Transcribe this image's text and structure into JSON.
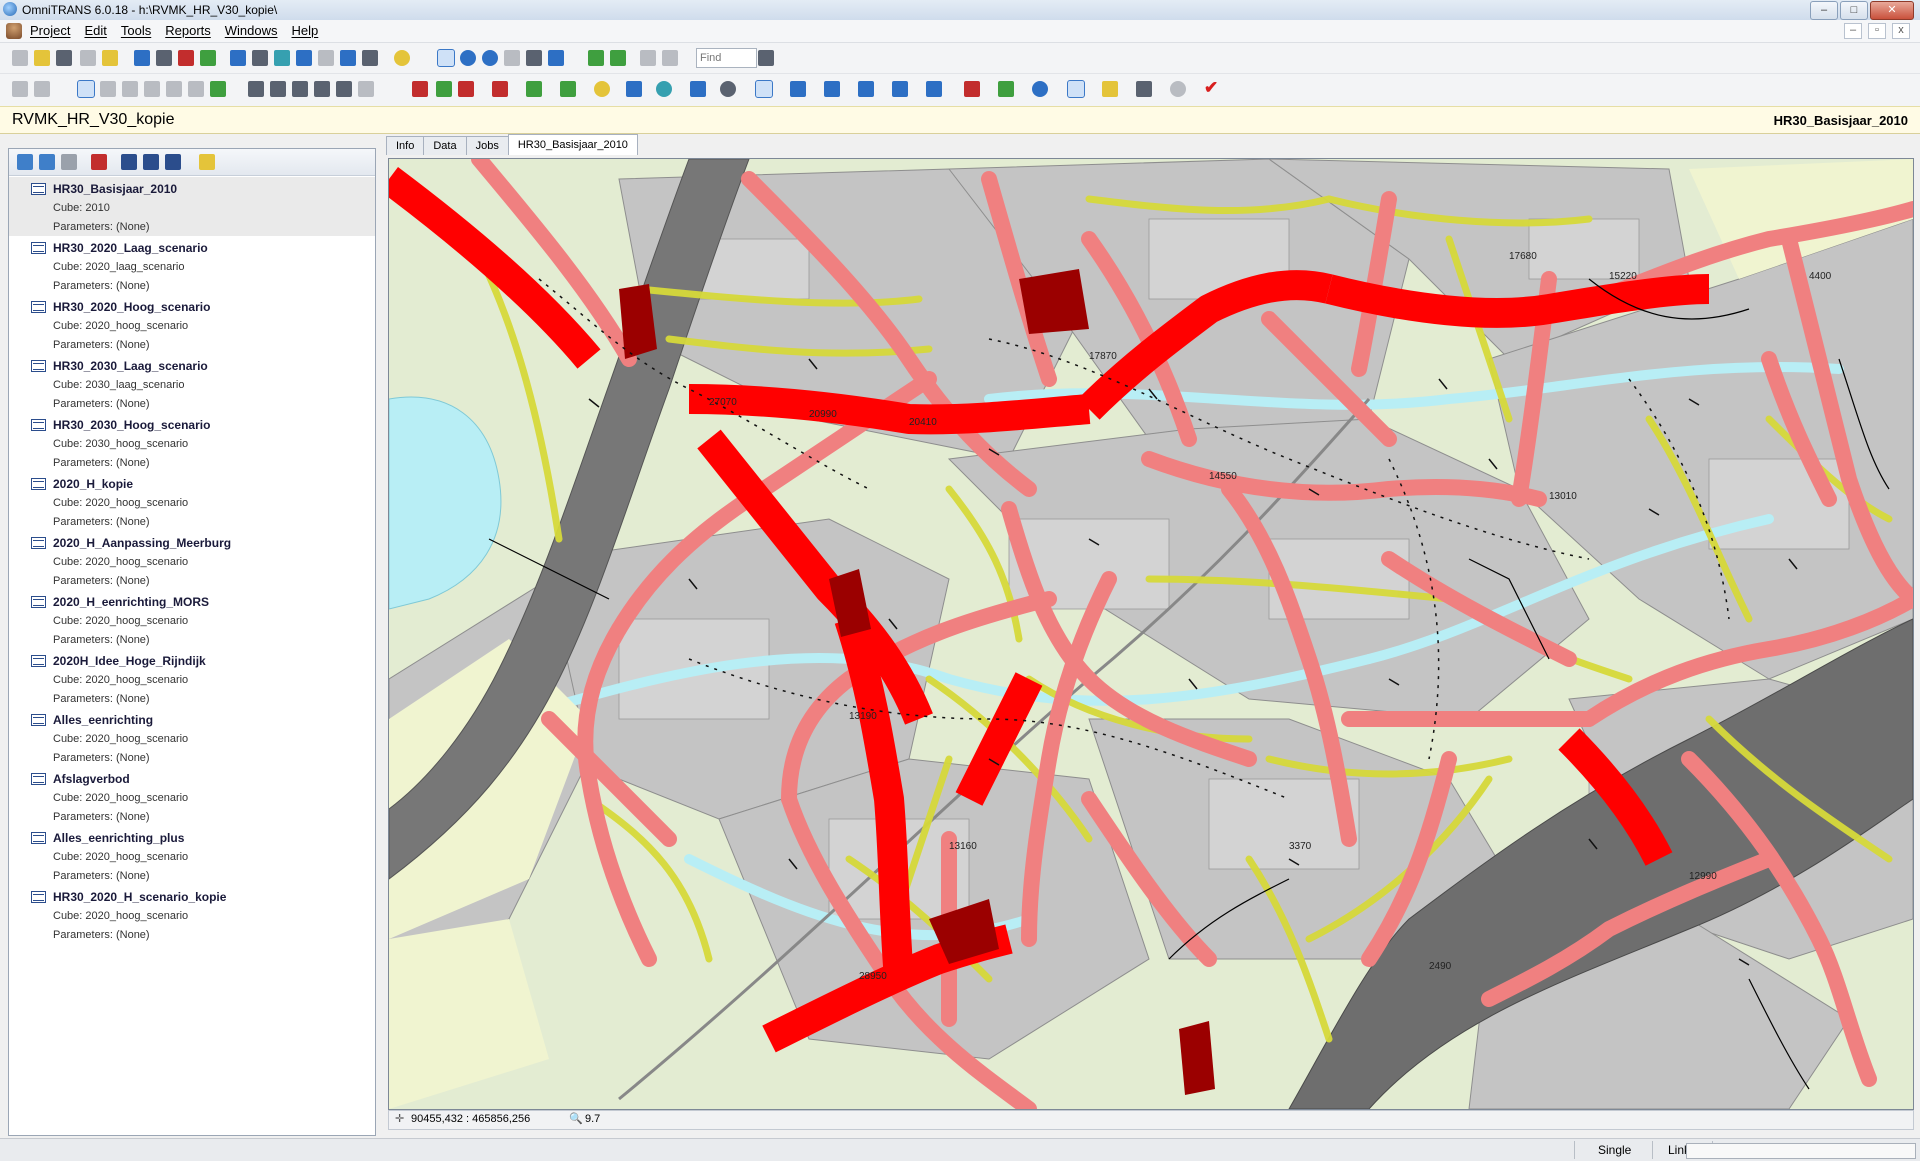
{
  "window": {
    "title": "OmniTRANS 6.0.18 - h:\\RVMK_HR_V30_kopie\\",
    "buttons": {
      "minimize": "–",
      "maximize": "□",
      "close": "✕"
    }
  },
  "menu": {
    "items": [
      "Project",
      "Edit",
      "Tools",
      "Reports",
      "Windows",
      "Help"
    ],
    "mdi": {
      "minimize": "–",
      "restore": "▫",
      "close": "x"
    }
  },
  "toolbar": {
    "find_placeholder": "Find"
  },
  "project": {
    "name": "RVMK_HR_V30_kopie",
    "variant": "HR30_Basisjaar_2010"
  },
  "scenarios": [
    {
      "name": "HR30_Basisjaar_2010",
      "cube": "Cube: 2010",
      "params": "Parameters: (None)",
      "selected": true
    },
    {
      "name": "HR30_2020_Laag_scenario",
      "cube": "Cube: 2020_laag_scenario",
      "params": "Parameters: (None)"
    },
    {
      "name": "HR30_2020_Hoog_scenario",
      "cube": "Cube: 2020_hoog_scenario",
      "params": "Parameters: (None)"
    },
    {
      "name": "HR30_2030_Laag_scenario",
      "cube": "Cube: 2030_laag_scenario",
      "params": "Parameters: (None)"
    },
    {
      "name": "HR30_2030_Hoog_scenario",
      "cube": "Cube: 2030_hoog_scenario",
      "params": "Parameters: (None)"
    },
    {
      "name": "2020_H_kopie",
      "cube": "Cube: 2020_hoog_scenario",
      "params": "Parameters: (None)"
    },
    {
      "name": "2020_H_Aanpassing_Meerburg",
      "cube": "Cube: 2020_hoog_scenario",
      "params": "Parameters: (None)"
    },
    {
      "name": "2020_H_eenrichting_MORS",
      "cube": "Cube: 2020_hoog_scenario",
      "params": "Parameters: (None)"
    },
    {
      "name": "2020H_Idee_Hoge_Rijndijk",
      "cube": "Cube: 2020_hoog_scenario",
      "params": "Parameters: (None)"
    },
    {
      "name": "Alles_eenrichting",
      "cube": "Cube: 2020_hoog_scenario",
      "params": "Parameters: (None)"
    },
    {
      "name": "Afslagverbod",
      "cube": "Cube: 2020_hoog_scenario",
      "params": "Parameters: (None)"
    },
    {
      "name": "Alles_eenrichting_plus",
      "cube": "Cube: 2020_hoog_scenario",
      "params": "Parameters: (None)"
    },
    {
      "name": "HR30_2020_H_scenario_kopie",
      "cube": "Cube: 2020_hoog_scenario",
      "params": "Parameters: (None)"
    }
  ],
  "tabs": [
    "Info",
    "Data",
    "Jobs",
    "HR30_Basisjaar_2010"
  ],
  "map": {
    "colors": {
      "heavy": "#ff0000",
      "medium": "#f08080",
      "light": "#d6d93a",
      "railway": "#6b6b6b",
      "water": "#b8eef5",
      "grass": "#e3ecd2",
      "urban": "#bfbfbf"
    },
    "labels": [
      "27070",
      "20990",
      "20410",
      "14550",
      "17870",
      "15220",
      "17680",
      "13190",
      "28950",
      "13160",
      "12990",
      "3370",
      "2490",
      "4400",
      "13010"
    ],
    "coordinates": "90455,432 : 465856,256",
    "zoom": "9.7"
  },
  "status": {
    "mode": "Single",
    "object": "Links"
  }
}
